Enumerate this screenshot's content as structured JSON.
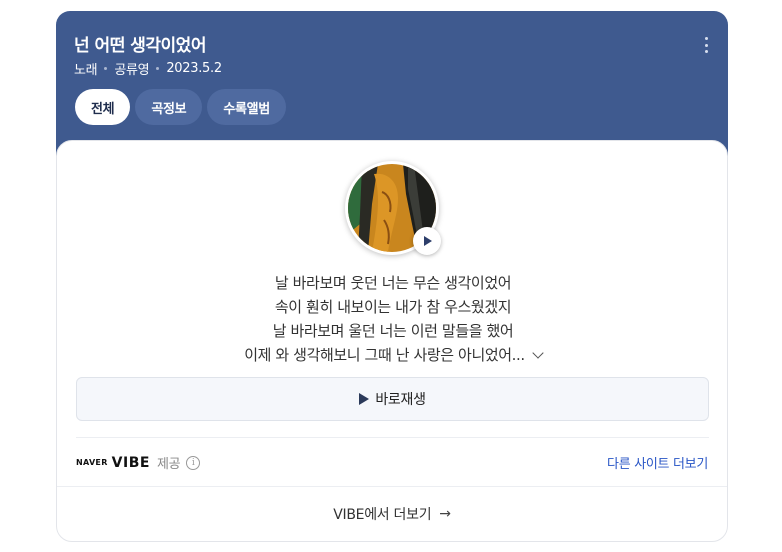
{
  "header": {
    "title": "넌 어떤 생각이었어",
    "meta": [
      "노래",
      "공류영",
      "2023.5.2"
    ]
  },
  "tabs": [
    {
      "label": "전체",
      "active": true
    },
    {
      "label": "곡정보",
      "active": false
    },
    {
      "label": "수록앨범",
      "active": false
    }
  ],
  "lyrics": [
    "날 바라보며 웃던 너는 무슨 생각이었어",
    "속이 훤히 내보이는 내가 참 우스웠겠지",
    "날 바라보며 울던 너는 이런 말들을 했어",
    "이제 와 생각해보니 그때 난 사랑은 아니었어..."
  ],
  "play_button": {
    "label": "바로재생"
  },
  "provider": {
    "naver": "NAVER",
    "vibe": "VIBE",
    "provide": "제공",
    "info_icon": "i",
    "other_site": "다른 사이트 더보기"
  },
  "footer": {
    "vibe_more": "VIBE에서 더보기",
    "arrow": "→"
  },
  "colors": {
    "header_bg": "#3f5a8f",
    "link": "#2956c6",
    "accent": "#2b3a5a"
  }
}
